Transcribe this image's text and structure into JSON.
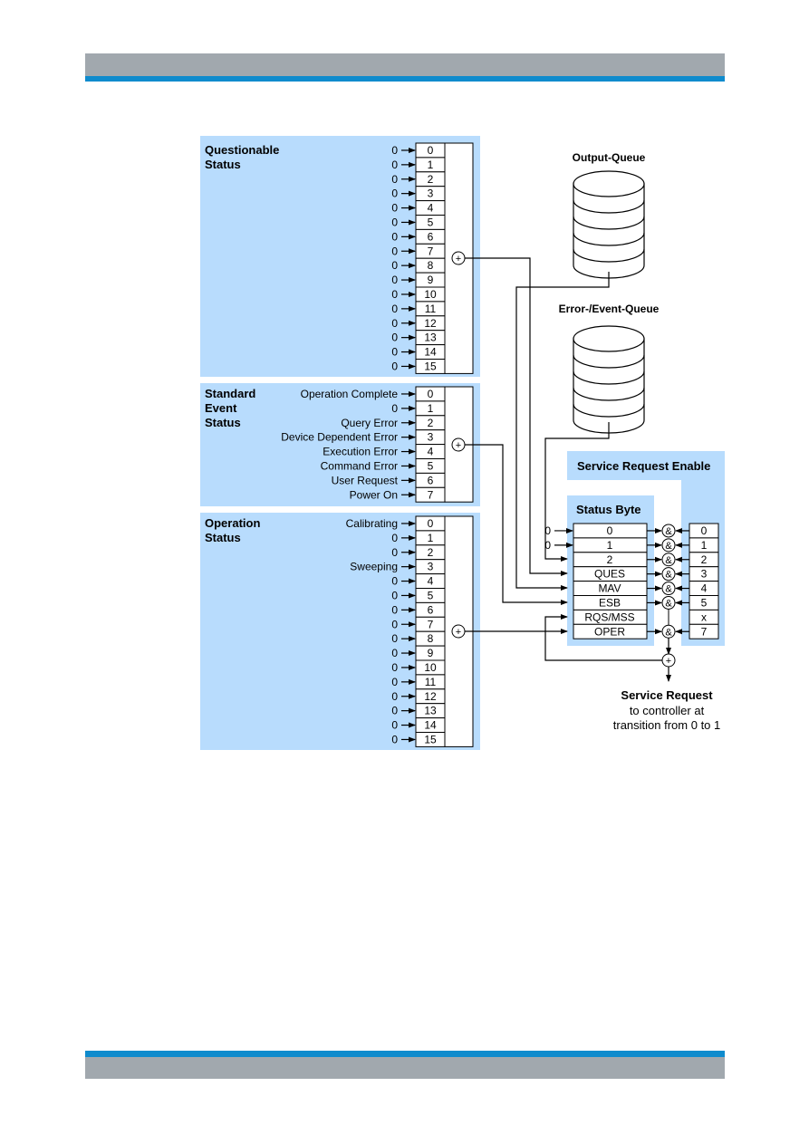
{
  "page": {
    "header_band": {
      "colors": {
        "gray": "#a1a8ae",
        "blue": "#0f8bcd"
      }
    },
    "footer_band": {
      "colors": {
        "gray": "#a1a8ae",
        "blue": "#0f8bcd"
      }
    }
  },
  "diagram": {
    "panel_color": "#b8dcfd",
    "questionable": {
      "title_line1": "Questionable",
      "title_line2": "Status",
      "inputs": [
        "0",
        "0",
        "0",
        "0",
        "0",
        "0",
        "0",
        "0",
        "0",
        "0",
        "0",
        "0",
        "0",
        "0",
        "0",
        "0"
      ],
      "bits": [
        "0",
        "1",
        "2",
        "3",
        "4",
        "5",
        "6",
        "7",
        "8",
        "9",
        "10",
        "11",
        "12",
        "13",
        "14",
        "15"
      ],
      "sum_symbol": "+"
    },
    "standard_event": {
      "title_line1": "Standard",
      "title_line2": "Event",
      "title_line3": "Status",
      "inputs": [
        "Operation Complete",
        "0",
        "Query Error",
        "Device Dependent Error",
        "Execution Error",
        "Command Error",
        "User Request",
        "Power On"
      ],
      "bits": [
        "0",
        "1",
        "2",
        "3",
        "4",
        "5",
        "6",
        "7"
      ],
      "sum_symbol": "+"
    },
    "operation": {
      "title_line1": "Operation",
      "title_line2": "Status",
      "inputs": [
        "Calibrating",
        "0",
        "0",
        "Sweeping",
        "0",
        "0",
        "0",
        "0",
        "0",
        "0",
        "0",
        "0",
        "0",
        "0",
        "0",
        "0"
      ],
      "bits": [
        "0",
        "1",
        "2",
        "3",
        "4",
        "5",
        "6",
        "7",
        "8",
        "9",
        "10",
        "11",
        "12",
        "13",
        "14",
        "15"
      ],
      "sum_symbol": "+"
    },
    "output_queue": {
      "label": "Output-Queue"
    },
    "error_queue": {
      "label": "Error-/Event-Queue"
    },
    "service_request_enable": {
      "title": "Service Request Enable",
      "bits": [
        "0",
        "1",
        "2",
        "3",
        "4",
        "5",
        "x",
        "7"
      ]
    },
    "status_byte": {
      "title": "Status Byte",
      "inputs": [
        "0",
        "0"
      ],
      "bits": [
        "0",
        "1",
        "2",
        "QUES",
        "MAV",
        "ESB",
        "RQS/MSS",
        "OPER"
      ],
      "and_symbol": "&"
    },
    "service_request": {
      "sum_symbol": "+",
      "title": "Service Request",
      "line2": "to controller at",
      "line3": "transition from 0 to 1"
    }
  }
}
